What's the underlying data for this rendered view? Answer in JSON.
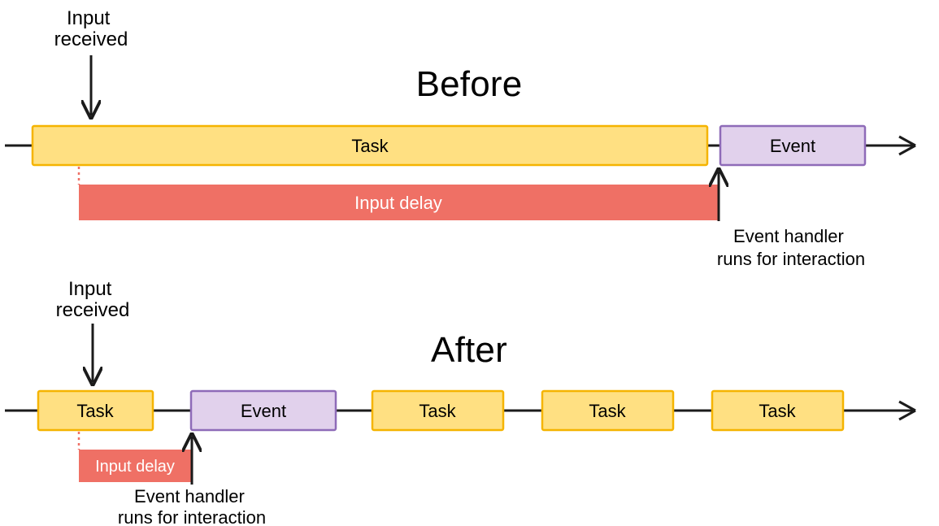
{
  "before": {
    "heading": "Before",
    "input_received": "Input\nreceived",
    "task": "Task",
    "event": "Event",
    "input_delay": "Input delay",
    "handler_caption_l1": "Event handler",
    "handler_caption_l2": "runs for interaction"
  },
  "after": {
    "heading": "After",
    "input_received": "Input\nreceived",
    "task": "Task",
    "event": "Event",
    "input_delay": "Input delay",
    "handler_caption_l1": "Event handler",
    "handler_caption_l2": "runs for interaction"
  }
}
